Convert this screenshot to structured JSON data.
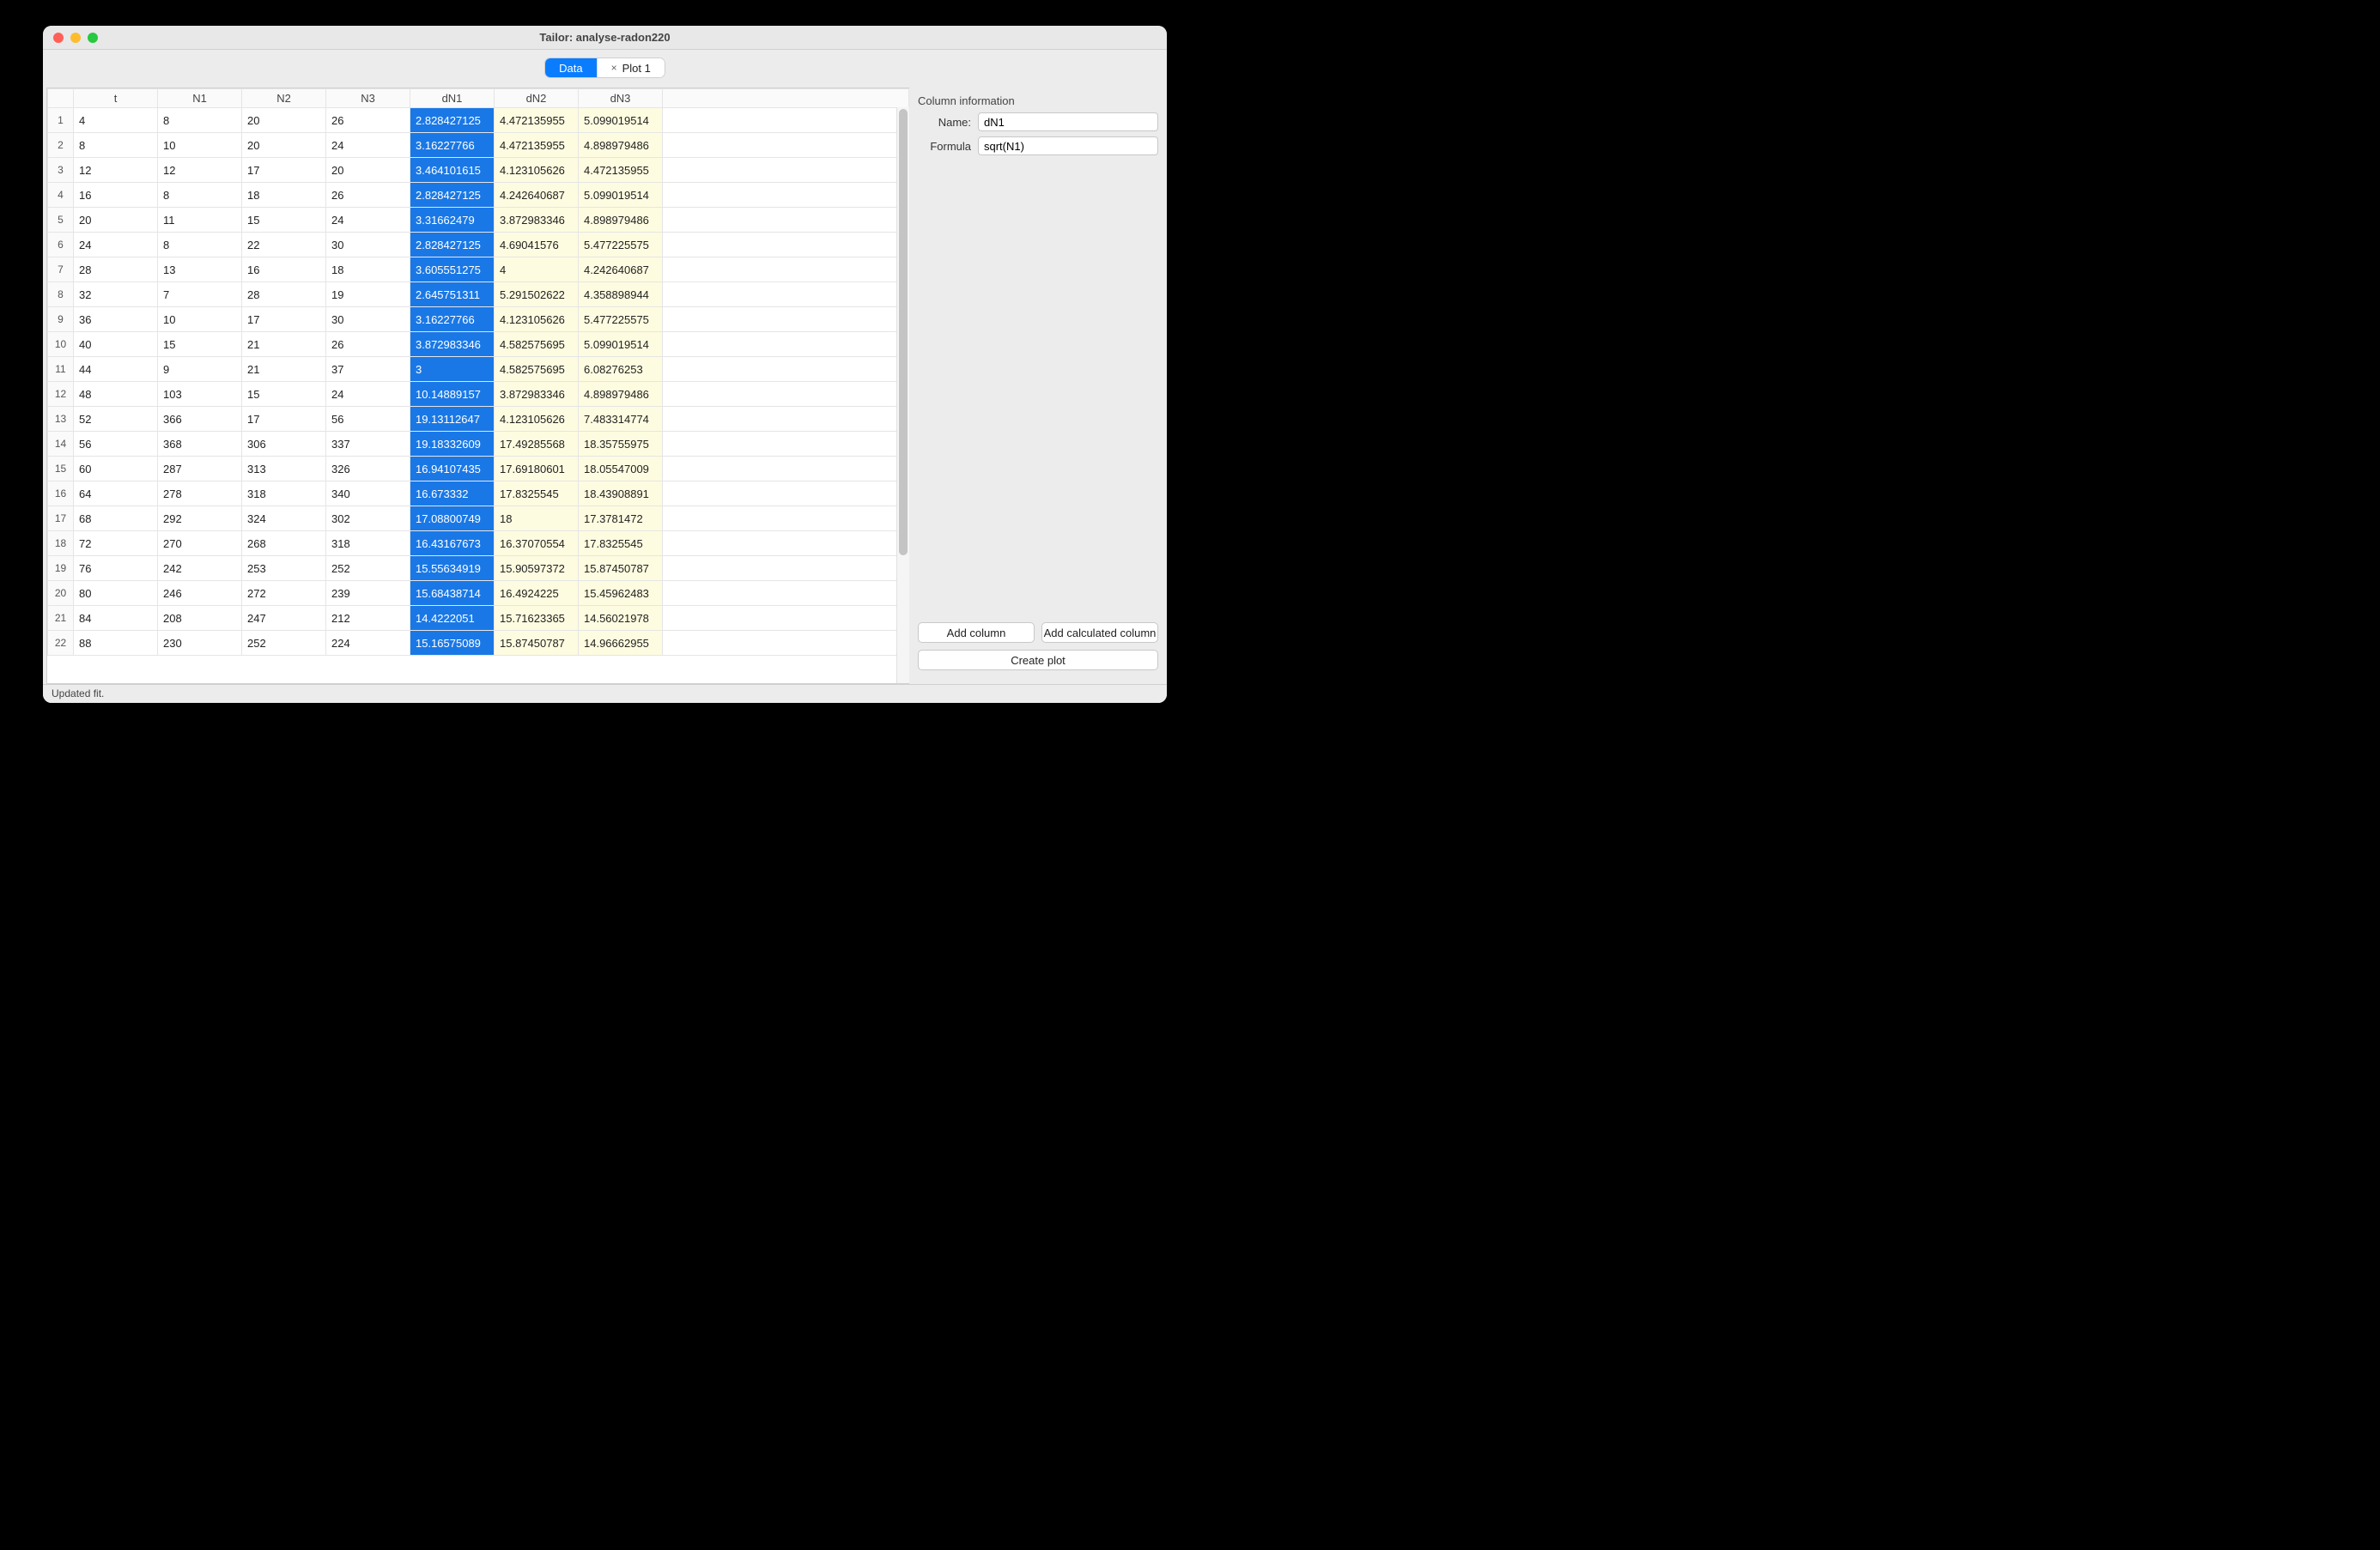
{
  "window": {
    "title": "Tailor: analyse-radon220"
  },
  "tabs": [
    {
      "label": "Data",
      "active": true,
      "closable": false
    },
    {
      "label": "Plot 1",
      "active": false,
      "closable": true
    }
  ],
  "columns": [
    "t",
    "N1",
    "N2",
    "N3",
    "dN1",
    "dN2",
    "dN3"
  ],
  "selected_column_index": 4,
  "calculated_column_indices": [
    4,
    5,
    6
  ],
  "rows": [
    [
      "4",
      "8",
      "20",
      "26",
      "2.828427125",
      "4.472135955",
      "5.099019514"
    ],
    [
      "8",
      "10",
      "20",
      "24",
      "3.16227766",
      "4.472135955",
      "4.898979486"
    ],
    [
      "12",
      "12",
      "17",
      "20",
      "3.464101615",
      "4.123105626",
      "4.472135955"
    ],
    [
      "16",
      "8",
      "18",
      "26",
      "2.828427125",
      "4.242640687",
      "5.099019514"
    ],
    [
      "20",
      "11",
      "15",
      "24",
      "3.31662479",
      "3.872983346",
      "4.898979486"
    ],
    [
      "24",
      "8",
      "22",
      "30",
      "2.828427125",
      "4.69041576",
      "5.477225575"
    ],
    [
      "28",
      "13",
      "16",
      "18",
      "3.605551275",
      "4",
      "4.242640687"
    ],
    [
      "32",
      "7",
      "28",
      "19",
      "2.645751311",
      "5.291502622",
      "4.358898944"
    ],
    [
      "36",
      "10",
      "17",
      "30",
      "3.16227766",
      "4.123105626",
      "5.477225575"
    ],
    [
      "40",
      "15",
      "21",
      "26",
      "3.872983346",
      "4.582575695",
      "5.099019514"
    ],
    [
      "44",
      "9",
      "21",
      "37",
      "3",
      "4.582575695",
      "6.08276253"
    ],
    [
      "48",
      "103",
      "15",
      "24",
      "10.14889157",
      "3.872983346",
      "4.898979486"
    ],
    [
      "52",
      "366",
      "17",
      "56",
      "19.13112647",
      "4.123105626",
      "7.483314774"
    ],
    [
      "56",
      "368",
      "306",
      "337",
      "19.18332609",
      "17.49285568",
      "18.35755975"
    ],
    [
      "60",
      "287",
      "313",
      "326",
      "16.94107435",
      "17.69180601",
      "18.05547009"
    ],
    [
      "64",
      "278",
      "318",
      "340",
      "16.673332",
      "17.8325545",
      "18.43908891"
    ],
    [
      "68",
      "292",
      "324",
      "302",
      "17.08800749",
      "18",
      "17.3781472"
    ],
    [
      "72",
      "270",
      "268",
      "318",
      "16.43167673",
      "16.37070554",
      "17.8325545"
    ],
    [
      "76",
      "242",
      "253",
      "252",
      "15.55634919",
      "15.90597372",
      "15.87450787"
    ],
    [
      "80",
      "246",
      "272",
      "239",
      "15.68438714",
      "16.4924225",
      "15.45962483"
    ],
    [
      "84",
      "208",
      "247",
      "212",
      "14.4222051",
      "15.71623365",
      "14.56021978"
    ],
    [
      "88",
      "230",
      "252",
      "224",
      "15.16575089",
      "15.87450787",
      "14.96662955"
    ]
  ],
  "column_info": {
    "heading": "Column information",
    "name_label": "Name:",
    "name_value": "dN1",
    "formula_label": "Formula",
    "formula_value": "sqrt(N1)"
  },
  "buttons": {
    "add_column": "Add column",
    "add_calculated": "Add calculated column",
    "create_plot": "Create plot"
  },
  "status": "Updated fit."
}
